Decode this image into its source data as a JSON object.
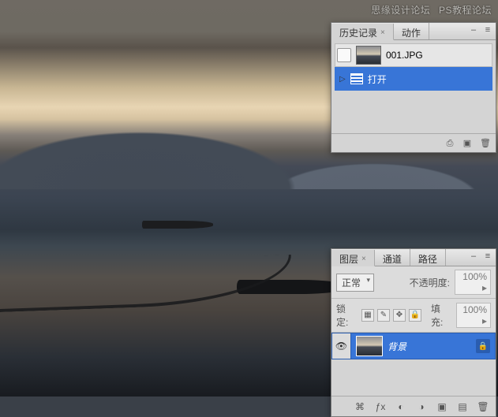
{
  "watermark": {
    "text1": "思缘设计论坛",
    "text2": "PS教程论坛"
  },
  "history_panel": {
    "tabs": [
      {
        "label": "历史记录",
        "active": true
      },
      {
        "label": "动作",
        "active": false
      }
    ],
    "source": {
      "filename": "001.JPG"
    },
    "steps": [
      {
        "label": "打开",
        "selected": true
      }
    ],
    "footer_icons": [
      "camera-icon",
      "new-icon",
      "trash-icon"
    ]
  },
  "layers_panel": {
    "tabs": [
      {
        "label": "图层",
        "active": true
      },
      {
        "label": "通道",
        "active": false
      },
      {
        "label": "路径",
        "active": false
      }
    ],
    "blend_mode": {
      "value": "正常"
    },
    "opacity": {
      "label": "不透明度:",
      "value": "100%"
    },
    "lock": {
      "label": "锁定:",
      "fill_label": "填充:",
      "fill_value": "100%"
    },
    "layers": [
      {
        "name": "背景",
        "locked": true,
        "selected": true
      }
    ],
    "footer_icons": [
      "link-icon",
      "fx-icon",
      "mask-icon",
      "adjust-icon",
      "group-icon",
      "new-icon",
      "trash-icon"
    ]
  }
}
